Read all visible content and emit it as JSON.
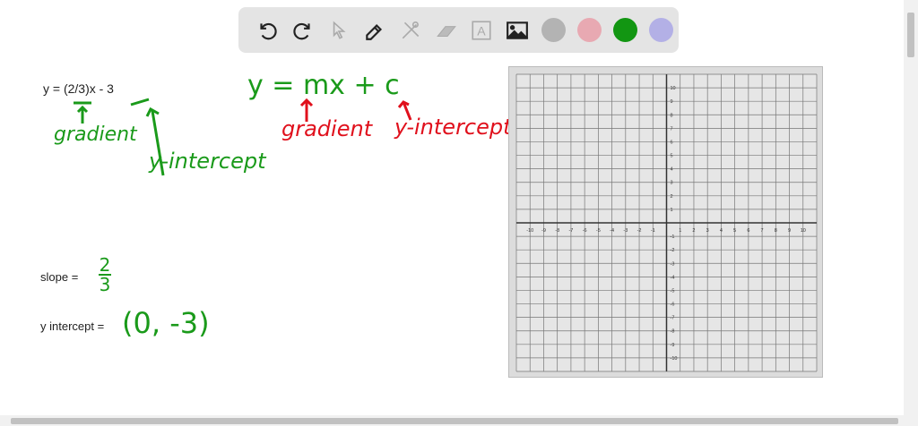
{
  "toolbar": {
    "tools": [
      "undo",
      "redo",
      "select",
      "pen",
      "tools",
      "eraser",
      "text",
      "image"
    ],
    "colors": [
      "#b3b3b3",
      "#e8a9b2",
      "#129612",
      "#b3b0e6"
    ],
    "text_tool_label": "A"
  },
  "notes": {
    "equation": "y = (2/3)x - 3",
    "gradient_label_green": "gradient",
    "yint_label_green": "y-intercept",
    "general_form": "y = mx + c",
    "gradient_label_red": "gradient",
    "yint_label_red": "y-intercept",
    "slope_label": "slope =",
    "slope_num": "2",
    "slope_den": "3",
    "yint_label": "y intercept =",
    "yint_value": "(0, -3)"
  },
  "graph": {
    "x_range": [
      -10,
      10
    ],
    "y_range": [
      -10,
      10
    ]
  }
}
